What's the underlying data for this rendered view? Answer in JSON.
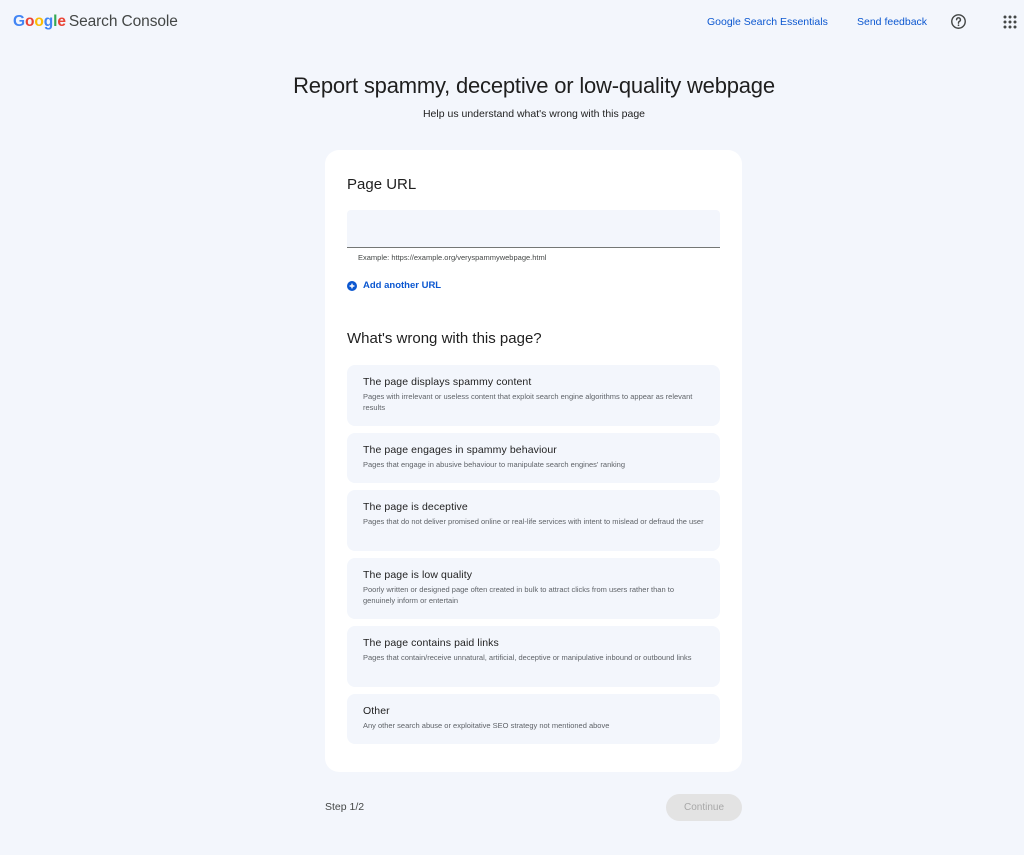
{
  "header": {
    "logo_letters": [
      "G",
      "o",
      "o",
      "g",
      "l",
      "e"
    ],
    "product_name": "Search Console",
    "essentials_link": "Google Search Essentials",
    "feedback_link": "Send feedback",
    "help_icon": "help-circle-icon",
    "apps_icon": "apps-grid-icon"
  },
  "page": {
    "title": "Report spammy, deceptive or low-quality webpage",
    "subtitle": "Help us understand what's wrong with this page"
  },
  "form": {
    "url_section_title": "Page URL",
    "url_value": "",
    "url_hint": "Example: https://example.org/veryspammywebpage.html",
    "add_url_label": "Add another URL",
    "reason_section_title": "What's wrong with this page?",
    "options": [
      {
        "title": "The page displays spammy content",
        "desc": "Pages with irrelevant or useless content that exploit search engine algorithms to appear as relevant results"
      },
      {
        "title": "The page engages in spammy behaviour",
        "desc": "Pages that engage in abusive behaviour to manipulate search engines' ranking"
      },
      {
        "title": "The page is deceptive",
        "desc": "Pages that do not deliver promised online or real-life services with intent to mislead or defraud the user"
      },
      {
        "title": "The page is low quality",
        "desc": "Poorly written or designed page often created in bulk to attract clicks from users rather than to genuinely inform or entertain"
      },
      {
        "title": "The page contains paid links",
        "desc": "Pages that contain/receive unnatural, artificial, deceptive or manipulative inbound or outbound links"
      },
      {
        "title": "Other",
        "desc": "Any other search abuse or exploitative SEO strategy not mentioned above"
      }
    ]
  },
  "footer": {
    "step_label": "Step 1/2",
    "continue_label": "Continue",
    "continue_disabled": true
  },
  "colors": {
    "background": "#f3f6fc",
    "link_blue": "#0b57d0",
    "card": "#ffffff"
  }
}
